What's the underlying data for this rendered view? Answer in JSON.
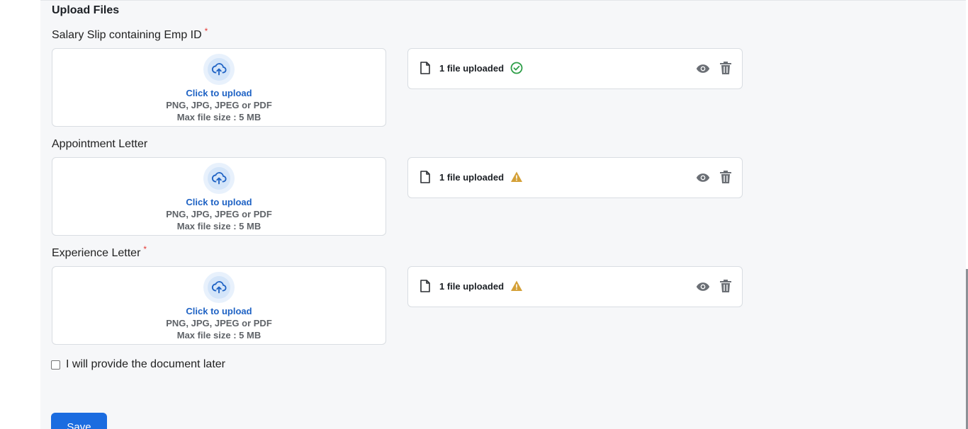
{
  "section": {
    "title": "Upload Files"
  },
  "required_mark": "*",
  "fields": [
    {
      "label": "Salary Slip containing Emp ID",
      "required": true,
      "dropzone": {
        "action": "Click to upload",
        "formats": "PNG, JPG, JPEG or PDF",
        "max_size": "Max file size : 5 MB"
      },
      "file": {
        "status_text": "1 file uploaded",
        "status_icon": "check-circle-icon",
        "status_color": "#2e9e48"
      }
    },
    {
      "label": "Appointment Letter",
      "required": false,
      "dropzone": {
        "action": "Click to upload",
        "formats": "PNG, JPG, JPEG or PDF",
        "max_size": "Max file size : 5 MB"
      },
      "file": {
        "status_text": "1 file uploaded",
        "status_icon": "warning-icon",
        "status_color": "#d4a037"
      }
    },
    {
      "label": "Experience Letter",
      "required": true,
      "dropzone": {
        "action": "Click to upload",
        "formats": "PNG, JPG, JPEG or PDF",
        "max_size": "Max file size : 5 MB"
      },
      "file": {
        "status_text": "1 file uploaded",
        "status_icon": "warning-icon",
        "status_color": "#d4a037"
      }
    }
  ],
  "later": {
    "label": "I will provide the document later",
    "checked": false
  },
  "save": {
    "label": "Save"
  },
  "colors": {
    "accent": "#1b6ce0",
    "link": "#1e62c4",
    "success": "#2e9e48",
    "warning": "#d4a037",
    "required": "#e53935"
  }
}
